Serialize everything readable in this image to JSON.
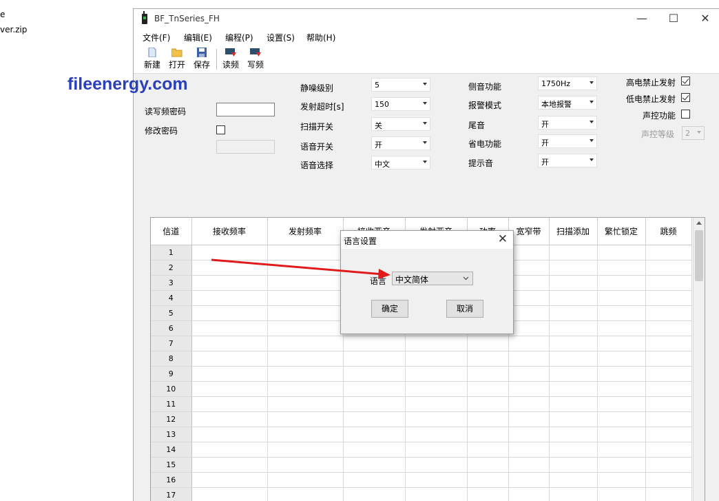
{
  "desktop": {
    "files": [
      "e",
      "ver.zip"
    ]
  },
  "watermark": "fileenergy.com",
  "window": {
    "title": "BF_TnSeries_FH",
    "controls": {
      "minimize": "—",
      "maximize": "☐",
      "close": "✕"
    }
  },
  "menu": [
    "文件(F)",
    "编辑(E)",
    "编程(P)",
    "设置(S)",
    "帮助(H)"
  ],
  "toolbar": [
    {
      "label": "新建",
      "icon": "new-file-icon"
    },
    {
      "label": "打开",
      "icon": "open-folder-icon"
    },
    {
      "label": "保存",
      "icon": "save-icon"
    },
    {
      "label": "读频",
      "icon": "read-radio-icon"
    },
    {
      "label": "写频",
      "icon": "write-radio-icon"
    }
  ],
  "password": {
    "read_write_label": "读写频密码",
    "read_write_value": "",
    "modify_label": "修改密码",
    "modify_checked": false,
    "modify_value": ""
  },
  "settings_col1": [
    {
      "label": "静噪级别",
      "value": "5"
    },
    {
      "label": "发射超时[s]",
      "value": "150"
    },
    {
      "label": "扫描开关",
      "value": "关"
    },
    {
      "label": "语音开关",
      "value": "开"
    },
    {
      "label": "语音选择",
      "value": "中文"
    }
  ],
  "settings_col2": [
    {
      "label": "侧音功能",
      "value": "1750Hz"
    },
    {
      "label": "报警模式",
      "value": "本地报警"
    },
    {
      "label": "尾音",
      "value": "开"
    },
    {
      "label": "省电功能",
      "value": "开"
    },
    {
      "label": "提示音",
      "value": "开"
    }
  ],
  "settings_col3": [
    {
      "label": "高电禁止发射",
      "checked": true
    },
    {
      "label": "低电禁止发射",
      "checked": true
    },
    {
      "label": "声控功能",
      "checked": false
    }
  ],
  "vox_level": {
    "label": "声控等级",
    "value": "2"
  },
  "grid": {
    "columns": [
      "信道",
      "接收频率",
      "发射频率",
      "接收亚音",
      "发射亚音",
      "功率",
      "宽窄带",
      "扫描添加",
      "繁忙锁定",
      "跳频"
    ],
    "rows": [
      "1",
      "2",
      "3",
      "4",
      "5",
      "6",
      "7",
      "8",
      "9",
      "10",
      "11",
      "12",
      "13",
      "14",
      "15",
      "16",
      "17"
    ]
  },
  "dialog": {
    "title": "语言设置",
    "close": "✕",
    "language_label": "语言",
    "language_value": "中文简体",
    "ok": "确定",
    "cancel": "取消"
  },
  "colors": {
    "watermark": "#2a3fb8",
    "arrow": "#e01b1b"
  }
}
